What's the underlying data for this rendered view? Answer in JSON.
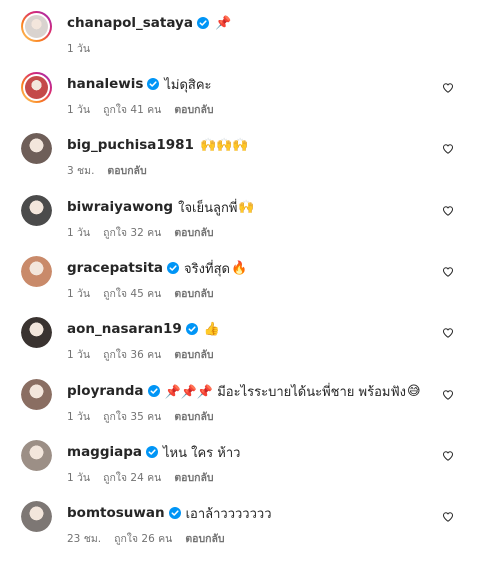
{
  "comments": [
    {
      "username": "chanapol_sataya",
      "verified": true,
      "text": "",
      "emoji": "📌",
      "time": "1 วัน",
      "likes": "",
      "reply": "",
      "heart": false,
      "avatar_ring": true,
      "avatar_color": "#d9d3cf"
    },
    {
      "username": "hanalewis",
      "verified": true,
      "text": "ไม่ดุสิคะ",
      "emoji": "",
      "time": "1 วัน",
      "likes": "ถูกใจ 41 คน",
      "reply": "ตอบกลับ",
      "heart": true,
      "avatar_ring": true,
      "avatar_color": "#c44a4a"
    },
    {
      "username": "big_puchisa1981",
      "verified": false,
      "text": "",
      "emoji": "🙌🙌🙌",
      "time": "3 ชม.",
      "likes": "",
      "reply": "ตอบกลับ",
      "heart": true,
      "avatar_ring": false,
      "avatar_color": "#6e5e58"
    },
    {
      "username": "biwraiyawong",
      "verified": false,
      "text": "ใจเย็นลูกพี่",
      "emoji": "🙌",
      "time": "1 วัน",
      "likes": "ถูกใจ 32 คน",
      "reply": "ตอบกลับ",
      "heart": true,
      "avatar_ring": false,
      "avatar_color": "#4b4b4b"
    },
    {
      "username": "gracepatsita",
      "verified": true,
      "text": "จริงที่สุด",
      "emoji": "🔥",
      "time": "1 วัน",
      "likes": "ถูกใจ 45 คน",
      "reply": "ตอบกลับ",
      "heart": true,
      "avatar_ring": false,
      "avatar_color": "#c98a6a"
    },
    {
      "username": "aon_nasaran19",
      "verified": true,
      "text": "",
      "emoji": "👍",
      "time": "1 วัน",
      "likes": "ถูกใจ 36 คน",
      "reply": "ตอบกลับ",
      "heart": true,
      "avatar_ring": false,
      "avatar_color": "#3a3330"
    },
    {
      "username": "ployranda",
      "verified": true,
      "text": "📌📌📌 มีอะไรระบายได้นะพี่ชาย พร้อมฟัง",
      "emoji": "😅",
      "time": "1 วัน",
      "likes": "ถูกใจ 35 คน",
      "reply": "ตอบกลับ",
      "heart": true,
      "avatar_ring": false,
      "avatar_color": "#8a6e62"
    },
    {
      "username": "maggiapa",
      "verified": true,
      "text": "ไหน ใคร ห้าว",
      "emoji": "",
      "time": "1 วัน",
      "likes": "ถูกใจ 24 คน",
      "reply": "ตอบกลับ",
      "heart": true,
      "avatar_ring": false,
      "avatar_color": "#9c8f86"
    },
    {
      "username": "bomtosuwan",
      "verified": true,
      "text": "เอาล้าววววววว",
      "emoji": "",
      "time": "23 ชม.",
      "likes": "ถูกใจ 26 คน",
      "reply": "ตอบกลับ",
      "heart": true,
      "avatar_ring": false,
      "avatar_color": "#7d7774"
    }
  ],
  "colors": {
    "verified": "#0095f6",
    "text": "#262626",
    "meta": "#737373"
  },
  "icons": {
    "verified": "verified-badge-icon",
    "like": "heart-outline-icon"
  }
}
